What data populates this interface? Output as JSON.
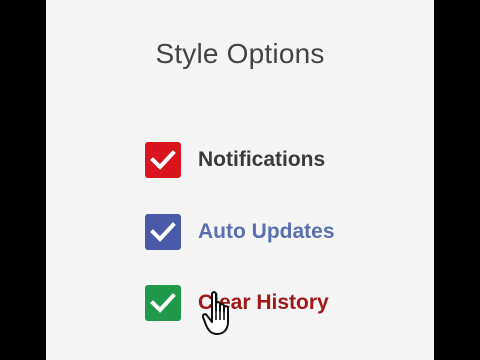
{
  "panel": {
    "title": "Style Options"
  },
  "options": [
    {
      "label": "Notifications",
      "checked": true,
      "box_color": "#d9141e",
      "text_color": "#3a3a3a"
    },
    {
      "label": "Auto Updates",
      "checked": true,
      "box_color": "#4a5aa8",
      "text_color": "#5a6fb0"
    },
    {
      "label": "Clear History",
      "checked": true,
      "box_color": "#1f9a4a",
      "text_color": "#a01818"
    }
  ],
  "icons": {
    "check": "check-icon",
    "cursor": "hand-pointer-icon"
  }
}
